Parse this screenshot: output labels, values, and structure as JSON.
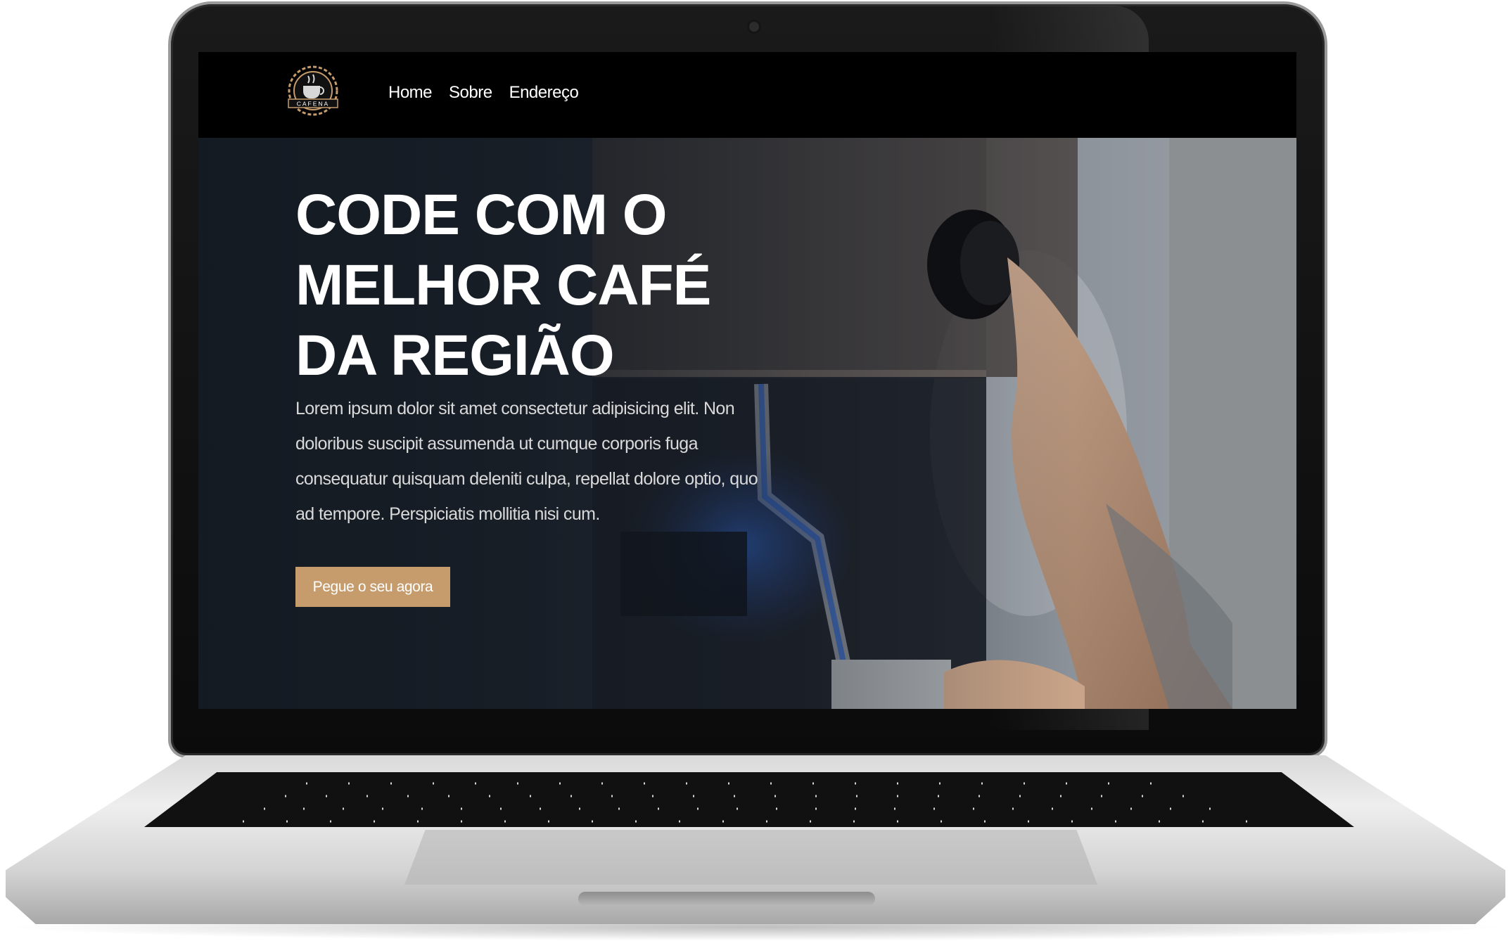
{
  "brand": {
    "logo_text": "CAFENA"
  },
  "nav": {
    "items": [
      {
        "label": "Home"
      },
      {
        "label": "Sobre"
      },
      {
        "label": "Endereço"
      }
    ]
  },
  "hero": {
    "title": "CODE COM O MELHOR CAFÉ DA REGIÃO",
    "text": "Lorem ipsum dolor sit amet consectetur adipisicing elit. Non doloribus suscipit assumenda ut cumque corporis fuga consequatur quisquam deleniti culpa, repellat dolore optio, quo ad tempore. Perspiciatis mollitia nisi cum.",
    "cta_label": "Pegue o seu agora"
  },
  "colors": {
    "accent": "#c69c6d",
    "nav_background": "#000000",
    "text_primary": "#ffffff"
  }
}
